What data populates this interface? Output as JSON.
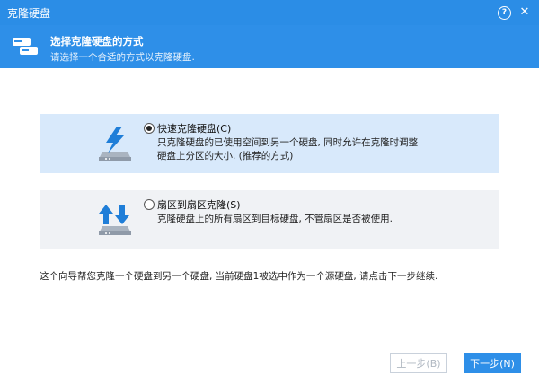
{
  "window": {
    "title": "克隆硬盘"
  },
  "header": {
    "title": "选择克隆硬盘的方式",
    "subtitle": "请选择一个合适的方式以克隆硬盘."
  },
  "options": [
    {
      "label": "快速克隆硬盘(C)",
      "description": "只克隆硬盘的已使用空间到另一个硬盘, 同时允许在克隆时调整硬盘上分区的大小. (推荐的方式)",
      "selected": true,
      "icon": "fast-clone-disk-icon"
    },
    {
      "label": "扇区到扇区克隆(S)",
      "description": "克隆硬盘上的所有扇区到目标硬盘, 不管扇区是否被使用.",
      "selected": false,
      "icon": "sector-clone-disk-icon"
    }
  ],
  "info_text": "这个向导帮您克隆一个硬盘到另一个硬盘, 当前硬盘1被选中作为一个源硬盘, 请点击下一步继续.",
  "buttons": {
    "prev": "上一步(B)",
    "next": "下一步(N)"
  },
  "colors": {
    "accent": "#2e8fe8",
    "selected_bg": "#d8e9fb",
    "option_bg": "#f0f2f5"
  }
}
